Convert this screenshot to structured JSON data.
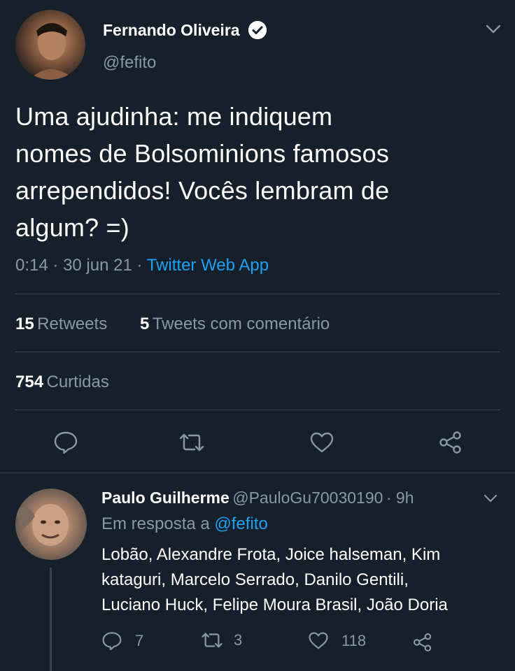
{
  "tweet": {
    "author_name": "Fernando Oliveira",
    "author_handle": "@fefito",
    "text_lines": [
      "Uma ajudinha: me indiquem",
      "nomes de Bolsominions famosos",
      "arrependidos! Vocês lembram de",
      "algum? =)"
    ],
    "time": "0:14",
    "date": "30 jun 21",
    "source": "Twitter Web App",
    "retweets_count": "15",
    "retweets_label": "Retweets",
    "quotes_count": "5",
    "quotes_label": "Tweets com comentário",
    "likes_count": "754",
    "likes_label": "Curtidas"
  },
  "reply": {
    "author_name": "Paulo Guilherme",
    "author_handle": "@PauloGu70030190",
    "age": "9h",
    "in_reply_prefix": "Em resposta a",
    "in_reply_handle": "@fefito",
    "text_lines": [
      "Lobão, Alexandre Frota, Joice halseman, Kim",
      "kataguri, Marcelo Serrado, Danilo Gentili,",
      "Luciano Huck, Felipe Moura Brasil, João Doria"
    ],
    "reply_count": "7",
    "retweet_count": "3",
    "like_count": "118"
  },
  "icons": {
    "verified": "verified-badge-icon",
    "chevron": "chevron-down-icon",
    "reply": "reply-icon",
    "retweet": "retweet-icon",
    "like": "heart-icon",
    "share": "share-icon"
  },
  "colors": {
    "background": "#15202b",
    "text": "#ffffff",
    "secondary": "#8899a6",
    "link": "#1da1f2",
    "divider": "#38444d"
  }
}
